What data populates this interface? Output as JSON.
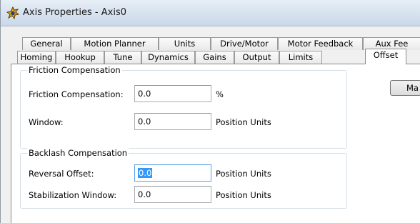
{
  "window": {
    "title": "Axis Properties - Axis0"
  },
  "tabs": {
    "row1": [
      "General",
      "Motion Planner",
      "Units",
      "Drive/Motor",
      "Motor Feedback",
      "Aux Fee"
    ],
    "row2": [
      "Homing",
      "Hookup",
      "Tune",
      "Dynamics",
      "Gains",
      "Output",
      "Limits",
      "Offset"
    ],
    "active": "Offset"
  },
  "friction": {
    "group_title": "Friction Compensation",
    "comp_label": "Friction Compensation:",
    "comp_value": "0.0",
    "comp_unit": "%",
    "window_label": "Window:",
    "window_value": "0.0",
    "window_unit": "Position Units"
  },
  "backlash": {
    "group_title": "Backlash Compensation",
    "reversal_label": "Reversal Offset:",
    "reversal_value": "0.0",
    "reversal_unit": "Position Units",
    "stab_label": "Stabilization Window:",
    "stab_value": "0.0",
    "stab_unit": "Position Units"
  },
  "side_button": {
    "label": "Ma"
  },
  "colors": {
    "titlebar": "#c9d8e9",
    "selection": "#3399ff",
    "group_border": "#d5dfe5"
  }
}
